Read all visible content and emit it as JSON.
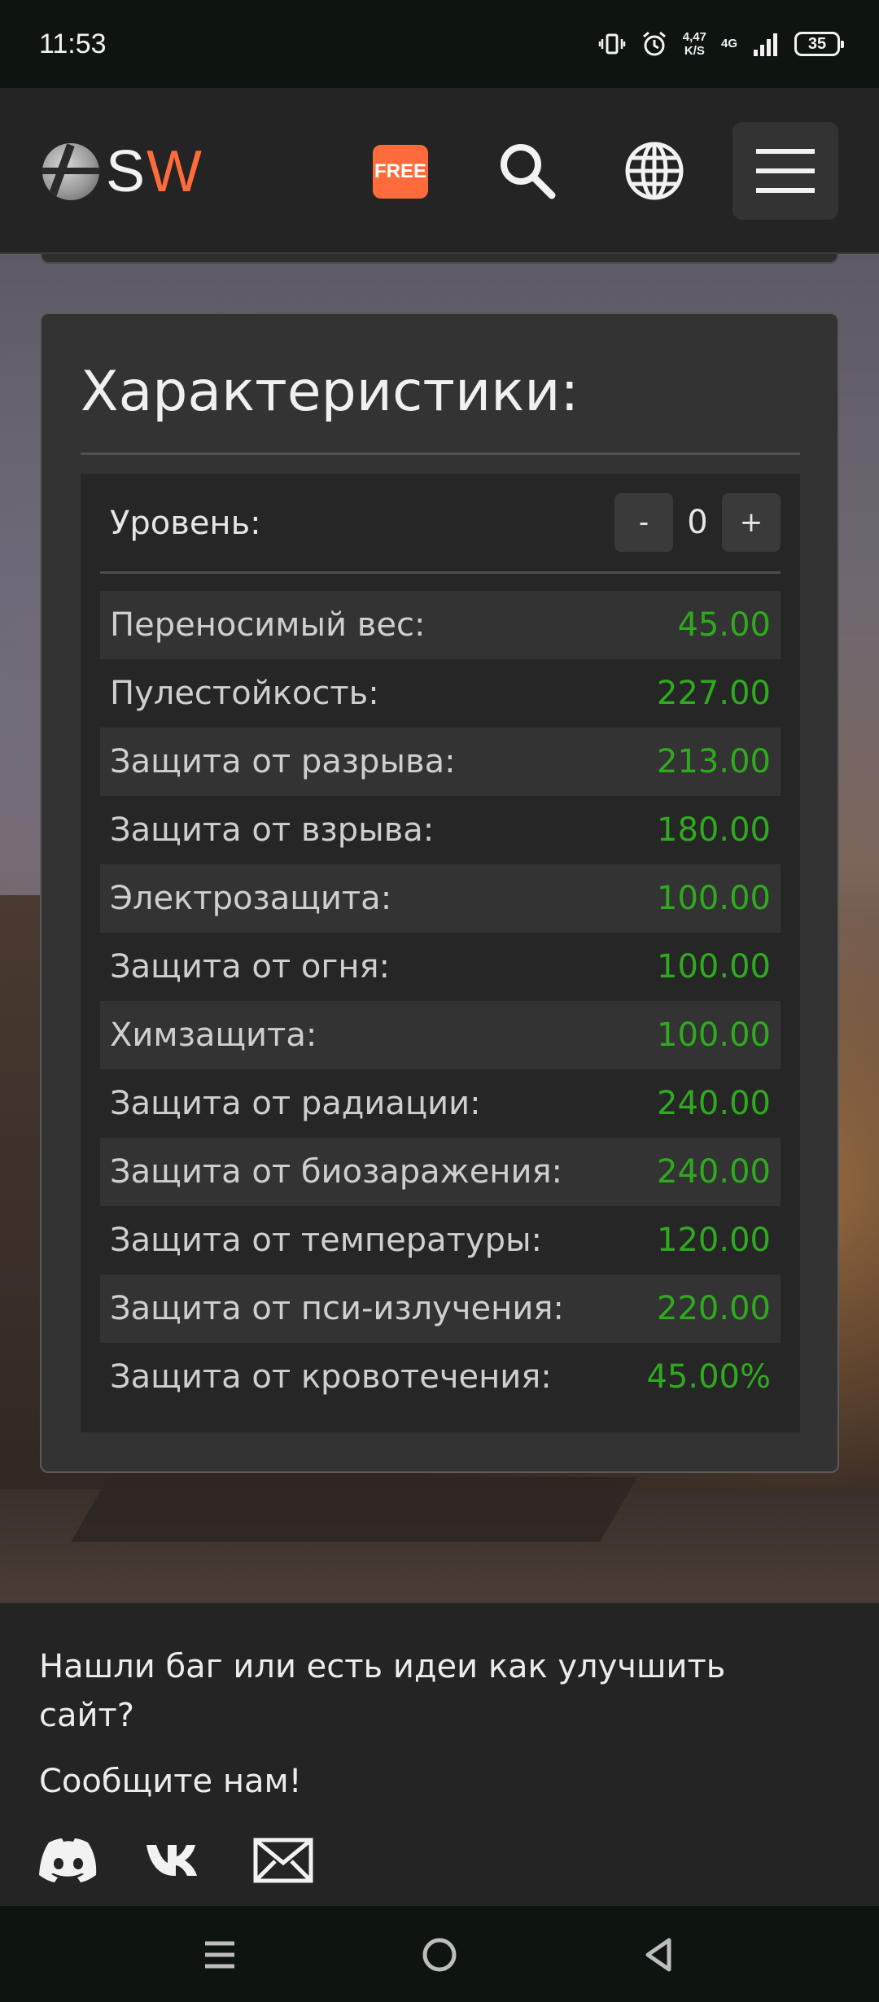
{
  "status_bar": {
    "time": "11:53",
    "speed_value": "4,47",
    "speed_unit": "K/S",
    "network": "4G",
    "battery": "35",
    "icons": [
      "vibrate-icon",
      "alarm-icon",
      "signal-icon",
      "battery-icon"
    ]
  },
  "header": {
    "logo_s": "S",
    "logo_w": "W",
    "free_badge": "FREE",
    "icons": [
      "search-icon",
      "globe-icon",
      "hamburger-menu-icon"
    ],
    "accent_color": "#ff6b3a"
  },
  "card": {
    "title": "Характеристики:",
    "level": {
      "label": "Уровень:",
      "minus_label": "-",
      "value": "0",
      "plus_label": "+"
    },
    "stats": [
      {
        "label": "Переносимый вес:",
        "value": "45.00"
      },
      {
        "label": "Пулестойкость:",
        "value": "227.00"
      },
      {
        "label": "Защита от разрыва:",
        "value": "213.00"
      },
      {
        "label": "Защита от взрыва:",
        "value": "180.00"
      },
      {
        "label": "Электрозащита:",
        "value": "100.00"
      },
      {
        "label": "Защита от огня:",
        "value": "100.00"
      },
      {
        "label": "Химзащита:",
        "value": "100.00"
      },
      {
        "label": "Защита от радиации:",
        "value": "240.00"
      },
      {
        "label": "Защита от биозаражения:",
        "value": "240.00"
      },
      {
        "label": "Защита от температуры:",
        "value": "120.00"
      },
      {
        "label": "Защита от пси-излучения:",
        "value": "220.00"
      },
      {
        "label": "Защита от кровотечения:",
        "value": "45.00%"
      }
    ],
    "value_color": "#2faa1e"
  },
  "footer": {
    "question": "Нашли баг или есть идеи как улучшить сайт?",
    "cta": "Сообщите нам!",
    "social_icons": [
      "discord-icon",
      "vk-icon",
      "mail-icon"
    ]
  },
  "navbar": {
    "icons": [
      "recent-apps-icon",
      "home-icon",
      "back-icon"
    ]
  }
}
